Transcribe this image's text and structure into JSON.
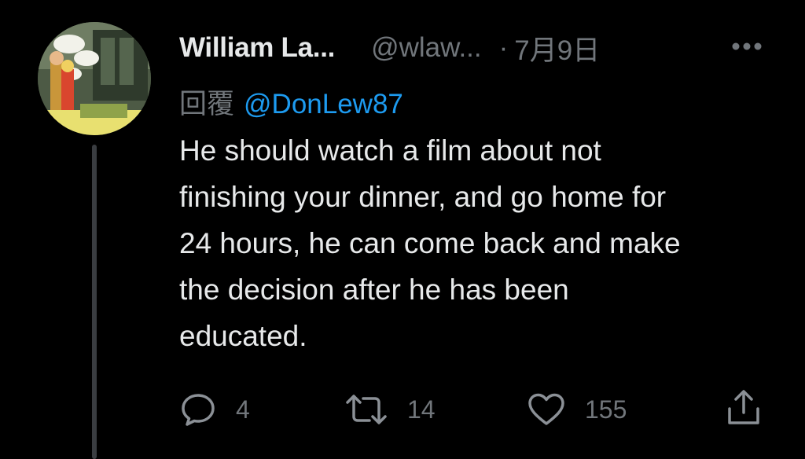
{
  "tweet": {
    "display_name": "William La...",
    "handle": "@wlaw...",
    "separator": "·",
    "date": "7月9日",
    "reply_prefix": "回覆",
    "reply_to": "@DonLew87",
    "body_lines": [
      "He should watch a film about not",
      "finishing your dinner, and go home for",
      "24 hours, he can come back and make",
      "the decision after he has been",
      "educated."
    ]
  },
  "actions": {
    "reply_count": "4",
    "retweet_count": "14",
    "like_count": "155"
  },
  "icons": {
    "more": "more-horizontal-icon",
    "reply": "reply-bubble-icon",
    "retweet": "retweet-icon",
    "like": "heart-icon",
    "share": "share-upload-icon"
  },
  "colors": {
    "background": "#000000",
    "primary_text": "#e7e9ea",
    "secondary_text": "#71767b",
    "link": "#1d9bf0",
    "thread_line": "#3a3d41"
  }
}
